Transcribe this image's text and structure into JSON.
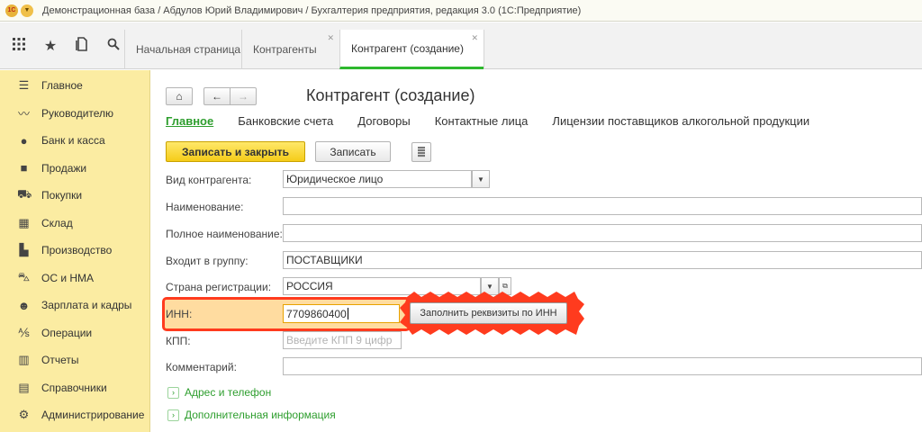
{
  "window": {
    "title": "Демонстрационная база / Абдулов Юрий Владимирович / Бухгалтерия предприятия, редакция 3.0  (1С:Предприятие)",
    "logo_text": "1С"
  },
  "toolbar": {
    "icons": [
      "apps-grid-icon",
      "star-icon",
      "history-icon",
      "search-icon"
    ],
    "tabs": [
      {
        "label": "Начальная страница",
        "closable": false
      },
      {
        "label": "Контрагенты",
        "closable": true
      },
      {
        "label": "Контрагент (создание)",
        "closable": true,
        "active": true
      }
    ]
  },
  "sidebar": {
    "items": [
      {
        "label": "Главное",
        "icon": "menu-lines-icon"
      },
      {
        "label": "Руководителю",
        "icon": "chart-line-icon"
      },
      {
        "label": "Банк и касса",
        "icon": "coin-icon"
      },
      {
        "label": "Продажи",
        "icon": "shopping-bag-icon"
      },
      {
        "label": "Покупки",
        "icon": "shopping-cart-icon"
      },
      {
        "label": "Склад",
        "icon": "warehouse-icon"
      },
      {
        "label": "Производство",
        "icon": "factory-icon"
      },
      {
        "label": "ОС и НМА",
        "icon": "car-icon"
      },
      {
        "label": "Зарплата и кадры",
        "icon": "people-icon"
      },
      {
        "label": "Операции",
        "icon": "operations-icon"
      },
      {
        "label": "Отчеты",
        "icon": "bar-chart-icon"
      },
      {
        "label": "Справочники",
        "icon": "books-icon"
      },
      {
        "label": "Администрирование",
        "icon": "gear-icon"
      }
    ]
  },
  "form": {
    "title": "Контрагент (создание)",
    "subtabs": [
      "Главное",
      "Банковские счета",
      "Договоры",
      "Контактные лица",
      "Лицензии поставщиков алкогольной продукции"
    ],
    "buttons": {
      "save_close": "Записать и закрыть",
      "save": "Записать"
    },
    "fields": {
      "type_label": "Вид контрагента:",
      "type_value": "Юридическое лицо",
      "name_label": "Наименование:",
      "name_value": "",
      "fullname_label": "Полное наименование:",
      "fullname_value": "",
      "group_label": "Входит в группу:",
      "group_value": "ПОСТАВЩИКИ",
      "country_label": "Страна регистрации:",
      "country_value": "РОССИЯ",
      "inn_label": "ИНН:",
      "inn_value": "7709860400",
      "kpp_label": "КПП:",
      "kpp_placeholder": "Введите КПП 9 цифр",
      "comment_label": "Комментарий:",
      "comment_value": ""
    },
    "fill_button": "Заполнить реквизиты по ИНН",
    "expanders": [
      "Адрес и телефон",
      "Дополнительная информация"
    ]
  },
  "colors": {
    "sidebar_bg": "#fbeca2",
    "accent_green": "#2e9e2e",
    "highlight_red": "#ff3b1e",
    "primary_button": "#f5cc18"
  }
}
